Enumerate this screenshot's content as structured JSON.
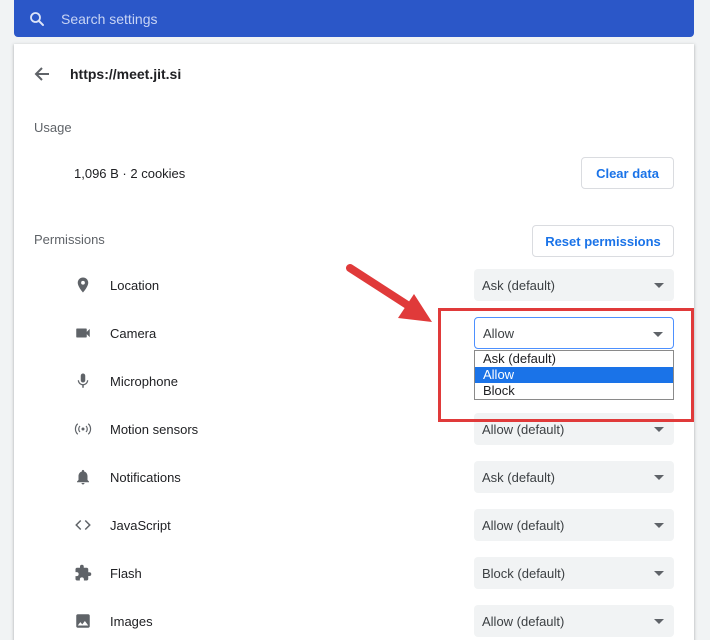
{
  "search": {
    "placeholder": "Search settings"
  },
  "site": {
    "url": "https://meet.jit.si"
  },
  "usage": {
    "heading": "Usage",
    "summary": "1,096 B · 2 cookies",
    "clear_label": "Clear data"
  },
  "permissions": {
    "heading": "Permissions",
    "reset_label": "Reset permissions",
    "items": [
      {
        "label": "Location",
        "value": "Ask (default)",
        "icon": "location-pin-icon"
      },
      {
        "label": "Camera",
        "value": "Allow",
        "icon": "camera-icon"
      },
      {
        "label": "Microphone",
        "value": "",
        "icon": "microphone-icon"
      },
      {
        "label": "Motion sensors",
        "value": "Allow (default)",
        "icon": "motion-sensors-icon"
      },
      {
        "label": "Notifications",
        "value": "Ask (default)",
        "icon": "bell-icon"
      },
      {
        "label": "JavaScript",
        "value": "Allow (default)",
        "icon": "code-brackets-icon"
      },
      {
        "label": "Flash",
        "value": "Block (default)",
        "icon": "puzzle-icon"
      },
      {
        "label": "Images",
        "value": "Allow (default)",
        "icon": "image-icon"
      }
    ]
  },
  "camera_dropdown": {
    "options": [
      "Ask (default)",
      "Allow",
      "Block"
    ],
    "selected": "Allow"
  },
  "annotation": {
    "color": "#e03a3a"
  },
  "colors": {
    "accent": "#1a73e8",
    "searchbar": "#2b57c8"
  }
}
